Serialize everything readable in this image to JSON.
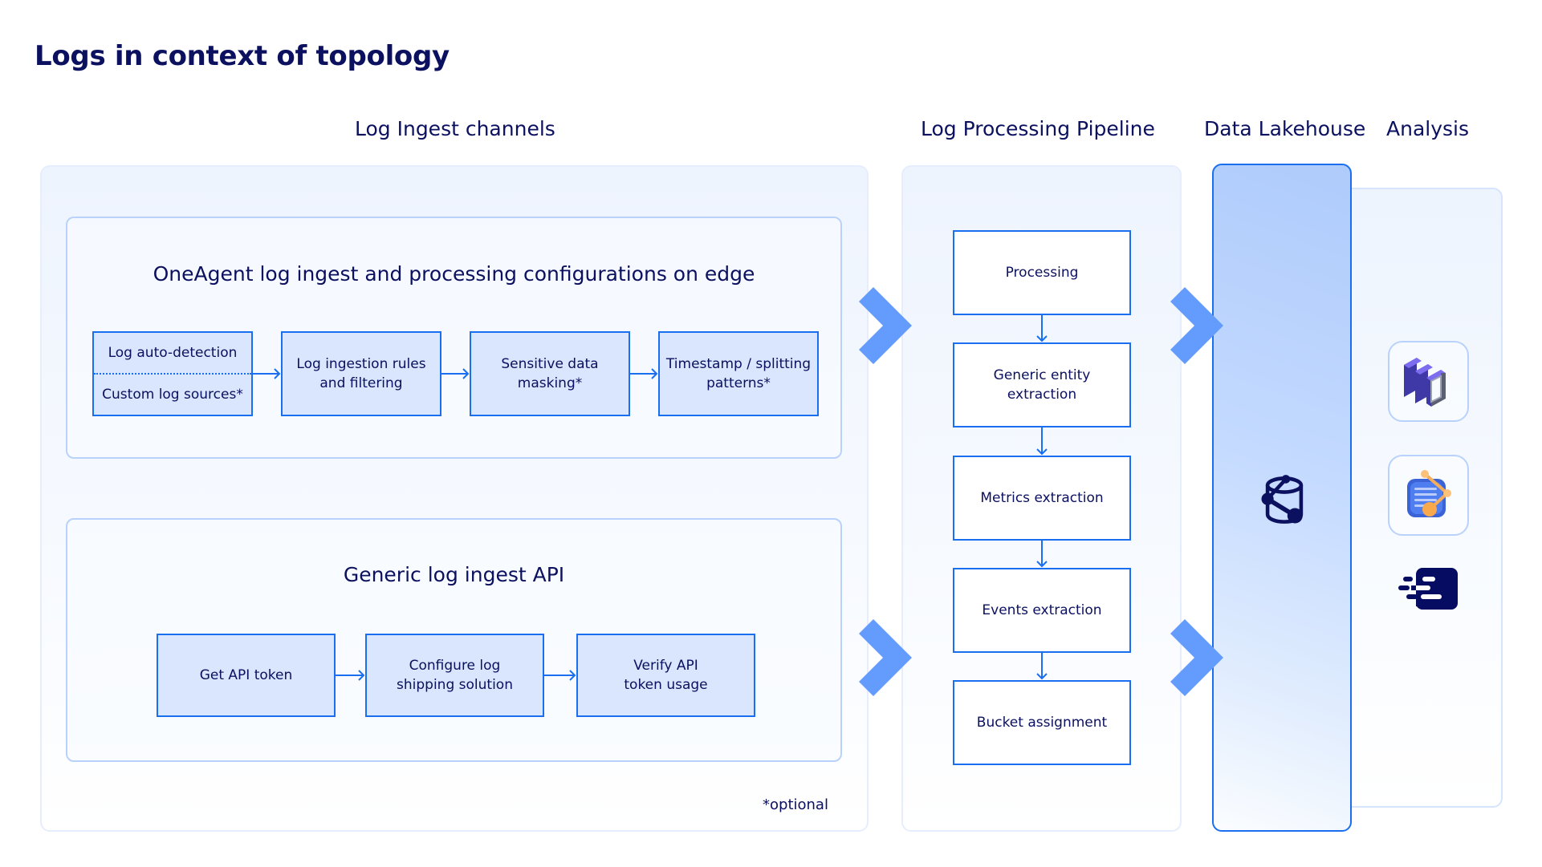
{
  "title": "Logs in context of topology",
  "columns": {
    "ingest": "Log Ingest channels",
    "pipeline": "Log Processing Pipeline",
    "lakehouse": "Data Lakehouse",
    "analysis": "Analysis"
  },
  "oneagent": {
    "title": "OneAgent log ingest and processing configurations on edge",
    "steps": [
      {
        "top": "Log auto-detection",
        "bottom": "Custom log sources*"
      },
      {
        "label": "Log ingestion rules\nand filtering"
      },
      {
        "label": "Sensitive data\nmasking*"
      },
      {
        "label": "Timestamp / splitting\npatterns*"
      }
    ]
  },
  "generic_api": {
    "title": "Generic log ingest API",
    "steps": [
      {
        "label": "Get API token"
      },
      {
        "label": "Configure log\nshipping solution"
      },
      {
        "label": "Verify API\ntoken usage"
      }
    ]
  },
  "pipeline": {
    "steps": [
      {
        "label": "Processing"
      },
      {
        "label": "Generic entity\nextraction"
      },
      {
        "label": "Metrics extraction"
      },
      {
        "label": "Events extraction"
      },
      {
        "label": "Bucket assignment"
      }
    ]
  },
  "lakehouse": {
    "icon": "data-lakehouse-bucket-icon"
  },
  "analysis": {
    "icons": [
      "dashboards-app-icon",
      "notebooks-app-icon",
      "logs-app-icon"
    ]
  },
  "footnote": "*optional",
  "colors": {
    "text": "#0b105f",
    "accent": "#1a6ff0",
    "chevron": "#649cfe",
    "step_fill": "#d9e6fd"
  }
}
